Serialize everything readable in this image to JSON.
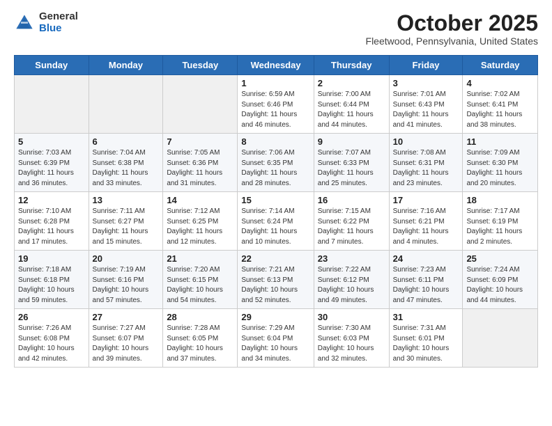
{
  "header": {
    "logo_general": "General",
    "logo_blue": "Blue",
    "title": "October 2025",
    "subtitle": "Fleetwood, Pennsylvania, United States"
  },
  "days_of_week": [
    "Sunday",
    "Monday",
    "Tuesday",
    "Wednesday",
    "Thursday",
    "Friday",
    "Saturday"
  ],
  "weeks": [
    [
      {
        "day": "",
        "sunrise": "",
        "sunset": "",
        "daylight": "",
        "empty": true
      },
      {
        "day": "",
        "sunrise": "",
        "sunset": "",
        "daylight": "",
        "empty": true
      },
      {
        "day": "",
        "sunrise": "",
        "sunset": "",
        "daylight": "",
        "empty": true
      },
      {
        "day": "1",
        "sunrise": "Sunrise: 6:59 AM",
        "sunset": "Sunset: 6:46 PM",
        "daylight": "Daylight: 11 hours and 46 minutes.",
        "empty": false
      },
      {
        "day": "2",
        "sunrise": "Sunrise: 7:00 AM",
        "sunset": "Sunset: 6:44 PM",
        "daylight": "Daylight: 11 hours and 44 minutes.",
        "empty": false
      },
      {
        "day": "3",
        "sunrise": "Sunrise: 7:01 AM",
        "sunset": "Sunset: 6:43 PM",
        "daylight": "Daylight: 11 hours and 41 minutes.",
        "empty": false
      },
      {
        "day": "4",
        "sunrise": "Sunrise: 7:02 AM",
        "sunset": "Sunset: 6:41 PM",
        "daylight": "Daylight: 11 hours and 38 minutes.",
        "empty": false
      }
    ],
    [
      {
        "day": "5",
        "sunrise": "Sunrise: 7:03 AM",
        "sunset": "Sunset: 6:39 PM",
        "daylight": "Daylight: 11 hours and 36 minutes.",
        "empty": false
      },
      {
        "day": "6",
        "sunrise": "Sunrise: 7:04 AM",
        "sunset": "Sunset: 6:38 PM",
        "daylight": "Daylight: 11 hours and 33 minutes.",
        "empty": false
      },
      {
        "day": "7",
        "sunrise": "Sunrise: 7:05 AM",
        "sunset": "Sunset: 6:36 PM",
        "daylight": "Daylight: 11 hours and 31 minutes.",
        "empty": false
      },
      {
        "day": "8",
        "sunrise": "Sunrise: 7:06 AM",
        "sunset": "Sunset: 6:35 PM",
        "daylight": "Daylight: 11 hours and 28 minutes.",
        "empty": false
      },
      {
        "day": "9",
        "sunrise": "Sunrise: 7:07 AM",
        "sunset": "Sunset: 6:33 PM",
        "daylight": "Daylight: 11 hours and 25 minutes.",
        "empty": false
      },
      {
        "day": "10",
        "sunrise": "Sunrise: 7:08 AM",
        "sunset": "Sunset: 6:31 PM",
        "daylight": "Daylight: 11 hours and 23 minutes.",
        "empty": false
      },
      {
        "day": "11",
        "sunrise": "Sunrise: 7:09 AM",
        "sunset": "Sunset: 6:30 PM",
        "daylight": "Daylight: 11 hours and 20 minutes.",
        "empty": false
      }
    ],
    [
      {
        "day": "12",
        "sunrise": "Sunrise: 7:10 AM",
        "sunset": "Sunset: 6:28 PM",
        "daylight": "Daylight: 11 hours and 17 minutes.",
        "empty": false
      },
      {
        "day": "13",
        "sunrise": "Sunrise: 7:11 AM",
        "sunset": "Sunset: 6:27 PM",
        "daylight": "Daylight: 11 hours and 15 minutes.",
        "empty": false
      },
      {
        "day": "14",
        "sunrise": "Sunrise: 7:12 AM",
        "sunset": "Sunset: 6:25 PM",
        "daylight": "Daylight: 11 hours and 12 minutes.",
        "empty": false
      },
      {
        "day": "15",
        "sunrise": "Sunrise: 7:14 AM",
        "sunset": "Sunset: 6:24 PM",
        "daylight": "Daylight: 11 hours and 10 minutes.",
        "empty": false
      },
      {
        "day": "16",
        "sunrise": "Sunrise: 7:15 AM",
        "sunset": "Sunset: 6:22 PM",
        "daylight": "Daylight: 11 hours and 7 minutes.",
        "empty": false
      },
      {
        "day": "17",
        "sunrise": "Sunrise: 7:16 AM",
        "sunset": "Sunset: 6:21 PM",
        "daylight": "Daylight: 11 hours and 4 minutes.",
        "empty": false
      },
      {
        "day": "18",
        "sunrise": "Sunrise: 7:17 AM",
        "sunset": "Sunset: 6:19 PM",
        "daylight": "Daylight: 11 hours and 2 minutes.",
        "empty": false
      }
    ],
    [
      {
        "day": "19",
        "sunrise": "Sunrise: 7:18 AM",
        "sunset": "Sunset: 6:18 PM",
        "daylight": "Daylight: 10 hours and 59 minutes.",
        "empty": false
      },
      {
        "day": "20",
        "sunrise": "Sunrise: 7:19 AM",
        "sunset": "Sunset: 6:16 PM",
        "daylight": "Daylight: 10 hours and 57 minutes.",
        "empty": false
      },
      {
        "day": "21",
        "sunrise": "Sunrise: 7:20 AM",
        "sunset": "Sunset: 6:15 PM",
        "daylight": "Daylight: 10 hours and 54 minutes.",
        "empty": false
      },
      {
        "day": "22",
        "sunrise": "Sunrise: 7:21 AM",
        "sunset": "Sunset: 6:13 PM",
        "daylight": "Daylight: 10 hours and 52 minutes.",
        "empty": false
      },
      {
        "day": "23",
        "sunrise": "Sunrise: 7:22 AM",
        "sunset": "Sunset: 6:12 PM",
        "daylight": "Daylight: 10 hours and 49 minutes.",
        "empty": false
      },
      {
        "day": "24",
        "sunrise": "Sunrise: 7:23 AM",
        "sunset": "Sunset: 6:11 PM",
        "daylight": "Daylight: 10 hours and 47 minutes.",
        "empty": false
      },
      {
        "day": "25",
        "sunrise": "Sunrise: 7:24 AM",
        "sunset": "Sunset: 6:09 PM",
        "daylight": "Daylight: 10 hours and 44 minutes.",
        "empty": false
      }
    ],
    [
      {
        "day": "26",
        "sunrise": "Sunrise: 7:26 AM",
        "sunset": "Sunset: 6:08 PM",
        "daylight": "Daylight: 10 hours and 42 minutes.",
        "empty": false
      },
      {
        "day": "27",
        "sunrise": "Sunrise: 7:27 AM",
        "sunset": "Sunset: 6:07 PM",
        "daylight": "Daylight: 10 hours and 39 minutes.",
        "empty": false
      },
      {
        "day": "28",
        "sunrise": "Sunrise: 7:28 AM",
        "sunset": "Sunset: 6:05 PM",
        "daylight": "Daylight: 10 hours and 37 minutes.",
        "empty": false
      },
      {
        "day": "29",
        "sunrise": "Sunrise: 7:29 AM",
        "sunset": "Sunset: 6:04 PM",
        "daylight": "Daylight: 10 hours and 34 minutes.",
        "empty": false
      },
      {
        "day": "30",
        "sunrise": "Sunrise: 7:30 AM",
        "sunset": "Sunset: 6:03 PM",
        "daylight": "Daylight: 10 hours and 32 minutes.",
        "empty": false
      },
      {
        "day": "31",
        "sunrise": "Sunrise: 7:31 AM",
        "sunset": "Sunset: 6:01 PM",
        "daylight": "Daylight: 10 hours and 30 minutes.",
        "empty": false
      },
      {
        "day": "",
        "sunrise": "",
        "sunset": "",
        "daylight": "",
        "empty": true
      }
    ]
  ]
}
